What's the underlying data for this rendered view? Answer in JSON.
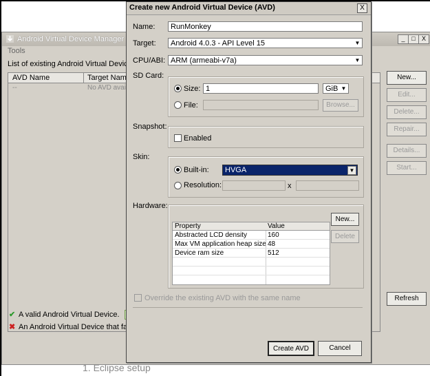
{
  "page_footer": "1.  Eclipse setup",
  "manager": {
    "title": "Android Virtual Device Manager",
    "menu": "Tools",
    "list_caption": "List of existing Android Virtual Devices loc",
    "columns": [
      "AVD Name",
      "Target Name"
    ],
    "empty_row": {
      "name": "--",
      "target": "No AVD availa"
    },
    "side_buttons": [
      {
        "label": "New...",
        "enabled": true
      },
      {
        "label": "Edit...",
        "enabled": false
      },
      {
        "label": "Delete...",
        "enabled": false
      },
      {
        "label": "Repair...",
        "enabled": false
      },
      {
        "label": "Details...",
        "enabled": false
      },
      {
        "label": "Start...",
        "enabled": false
      }
    ],
    "refresh": "Refresh",
    "legend": {
      "valid": "A valid Android Virtual Device.",
      "valid_extra": "A",
      "failed": "An Android Virtual Device that failed"
    },
    "window_buttons": [
      "_",
      "□",
      "X"
    ]
  },
  "dialog": {
    "title": "Create new Android Virtual Device (AVD)",
    "close": "X",
    "name_label": "Name:",
    "name_value": "RunMonkey",
    "target_label": "Target:",
    "target_value": "Android 4.0.3 - API Level 15",
    "cpu_label": "CPU/ABI:",
    "cpu_value": "ARM (armeabi-v7a)",
    "sdcard": {
      "label": "SD Card:",
      "size_label": "Size:",
      "size_value": "1",
      "size_unit": "GiB",
      "file_label": "File:",
      "browse": "Browse..."
    },
    "snapshot": {
      "label": "Snapshot:",
      "enabled_label": "Enabled"
    },
    "skin": {
      "label": "Skin:",
      "builtin_label": "Built-in:",
      "builtin_value": "HVGA",
      "resolution_label": "Resolution:",
      "x": "x"
    },
    "hardware": {
      "label": "Hardware:",
      "columns": [
        "Property",
        "Value"
      ],
      "rows": [
        {
          "property": "Abstracted LCD density",
          "value": "160"
        },
        {
          "property": "Max VM application heap size",
          "value": "48"
        },
        {
          "property": "Device ram size",
          "value": "512"
        }
      ],
      "new": "New...",
      "delete": "Delete"
    },
    "override_label": "Override the existing AVD with the same name",
    "create": "Create AVD",
    "cancel": "Cancel"
  },
  "colors": {
    "selection": "#0a246a",
    "dialog_bg": "#d4d0c8",
    "valid_mark": "#2e9a2e",
    "failed_mark": "#cc2020"
  }
}
